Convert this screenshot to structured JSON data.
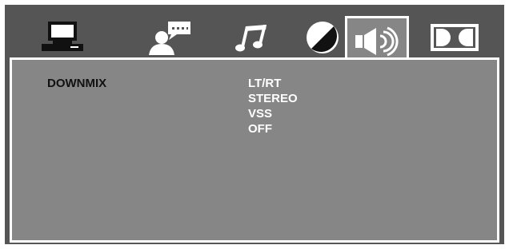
{
  "tabs": [
    {
      "id": "general",
      "icon": "monitor-icon",
      "active": false
    },
    {
      "id": "language",
      "icon": "person-speech-icon",
      "active": false
    },
    {
      "id": "audio",
      "icon": "music-note-icon",
      "active": false
    },
    {
      "id": "video",
      "icon": "contrast-circle-icon",
      "active": false
    },
    {
      "id": "speaker",
      "icon": "speaker-icon",
      "active": true
    },
    {
      "id": "dolby",
      "icon": "dolby-logo-icon",
      "active": false
    }
  ],
  "panel": {
    "setting_label": "DOWNMIX",
    "options": [
      "LT/RT",
      "STEREO",
      "VSS",
      "OFF"
    ]
  },
  "colors": {
    "background": "#555555",
    "panel": "#868686",
    "border": "#ffffff",
    "option_text": "#ffffff",
    "label_text": "#111111"
  }
}
